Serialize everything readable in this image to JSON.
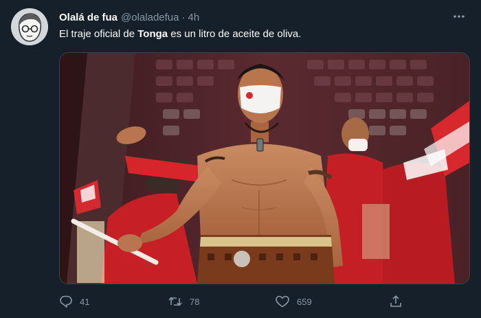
{
  "tweet": {
    "display_name": "Olalá de fua",
    "handle": "@olaladefua",
    "separator": "·",
    "time": "4h",
    "text_before": "El traje oficial de ",
    "text_bold": "Tonga",
    "text_after": " es un litro de aceite de oliva.",
    "more_icon": "more-horizontal-icon"
  },
  "actions": {
    "reply_count": "41",
    "retweet_count": "78",
    "like_count": "659",
    "reply_icon": "reply-icon",
    "retweet_icon": "retweet-icon",
    "like_icon": "heart-icon",
    "share_icon": "share-icon"
  },
  "colors": {
    "background": "#15202b",
    "text": "#ffffff",
    "muted": "#8899a6",
    "border": "#38444d"
  }
}
